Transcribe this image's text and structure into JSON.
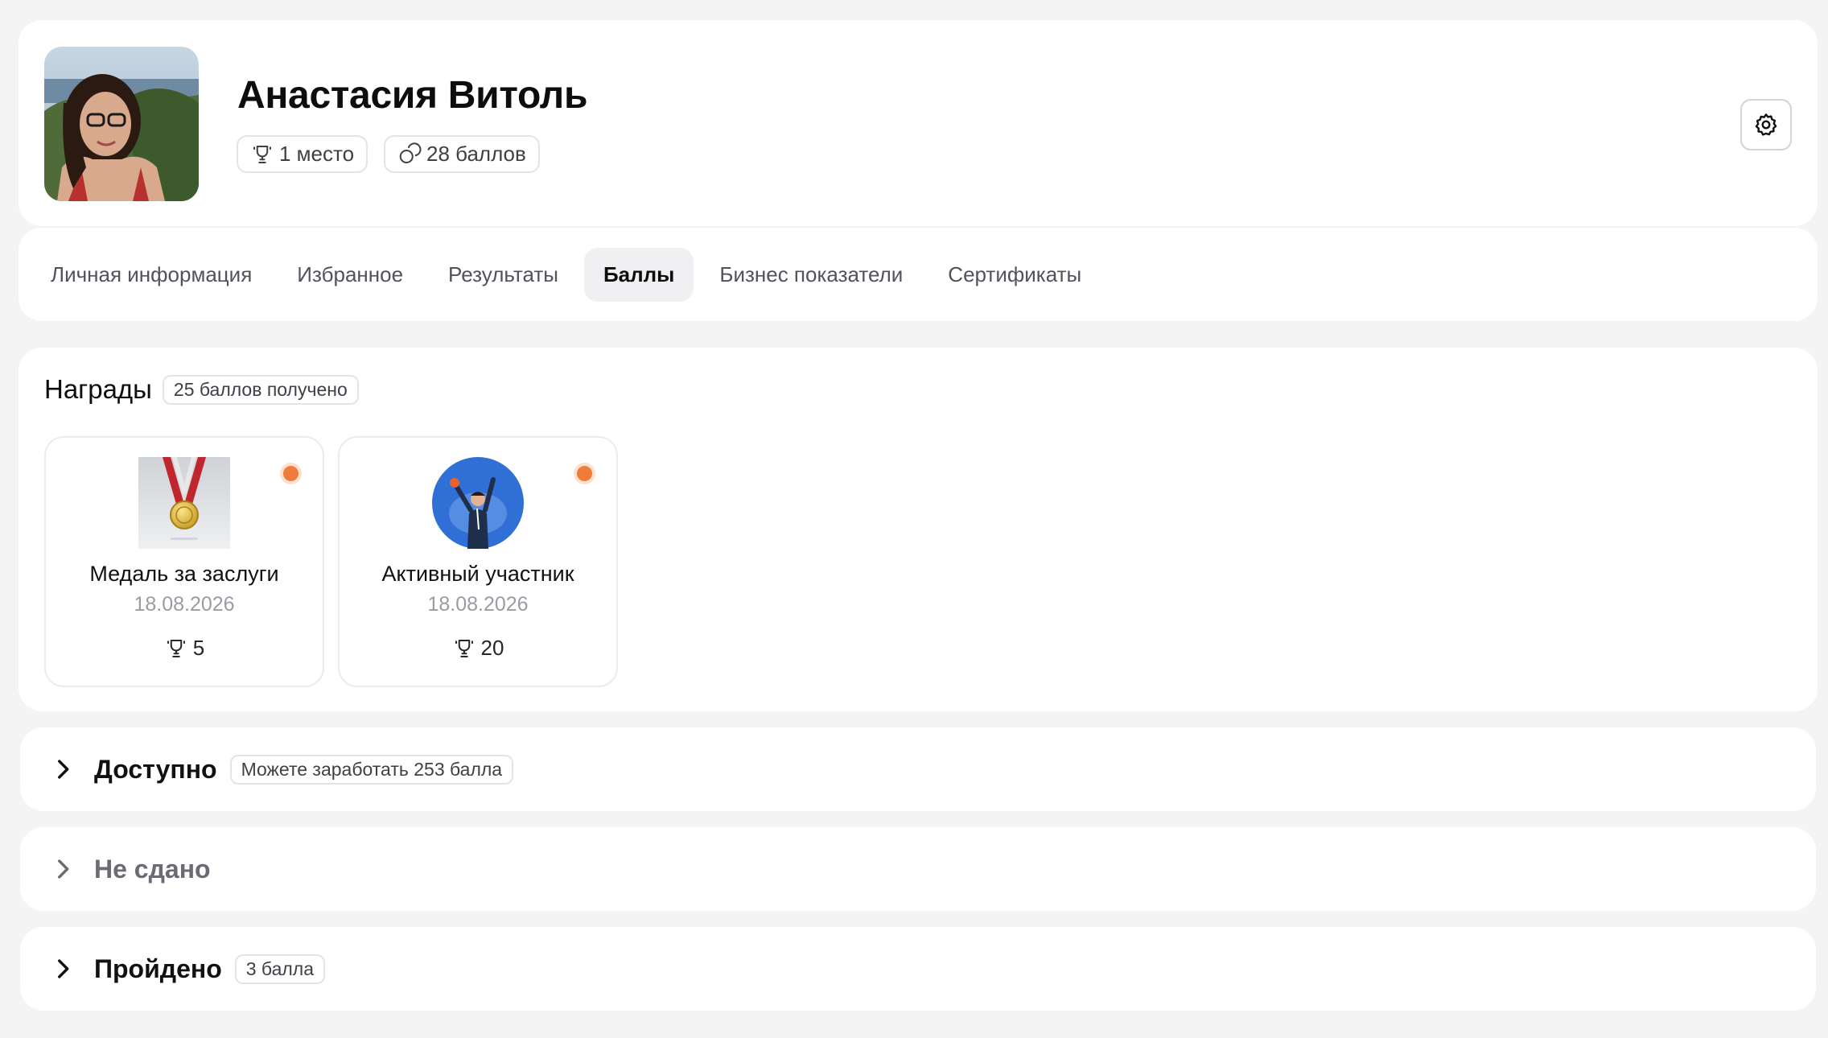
{
  "profile": {
    "name": "Анастасия Витоль",
    "rank_label": "1 место",
    "points_label": "28 баллов"
  },
  "tabs": [
    {
      "label": "Личная информация",
      "active": false
    },
    {
      "label": "Избранное",
      "active": false
    },
    {
      "label": "Результаты",
      "active": false
    },
    {
      "label": "Баллы",
      "active": true
    },
    {
      "label": "Бизнес показатели",
      "active": false
    },
    {
      "label": "Сертификаты",
      "active": false
    }
  ],
  "awards": {
    "title": "Награды",
    "badge": "25 баллов получено",
    "items": [
      {
        "name": "Медаль за заслуги",
        "date": "18.08.2026",
        "points": "5",
        "icon": "medal-icon"
      },
      {
        "name": "Активный участник",
        "date": "18.08.2026",
        "points": "20",
        "icon": "active-participant-icon"
      }
    ]
  },
  "sections": {
    "available": {
      "title": "Доступно",
      "badge": "Можете заработать 253 балла"
    },
    "failed": {
      "title": "Не сдано"
    },
    "passed": {
      "title": "Пройдено",
      "badge": "3 балла"
    }
  },
  "colors": {
    "background": "#f4f4f5",
    "card": "#ffffff",
    "new_indicator": "#f07c3b",
    "muted_text": "#9b9ba3"
  },
  "icons": {
    "trophy": "trophy-icon",
    "coins": "coins-icon",
    "settings": "gear-icon",
    "chevron": "chevron-right-icon"
  }
}
